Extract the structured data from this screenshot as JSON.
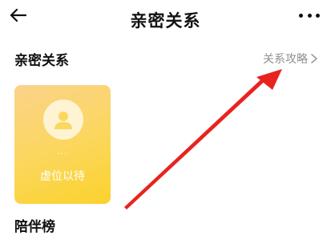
{
  "header": {
    "title": "亲密关系",
    "back_icon": "back-arrow-icon",
    "more_icon": "more-dots-icon"
  },
  "intimacy": {
    "section_title": "亲密关系",
    "guide_label": "关系攻略",
    "guide_icon": "chevron-right-icon",
    "card": {
      "avatar_icon": "user-icon",
      "name_text": "...",
      "slot_label": "虚位以待",
      "gradient_colors": [
        "#fbd28a",
        "#fbd22c"
      ]
    }
  },
  "companion": {
    "section_title": "陪伴榜"
  },
  "annotation": {
    "arrow_color": "#e8231f"
  }
}
